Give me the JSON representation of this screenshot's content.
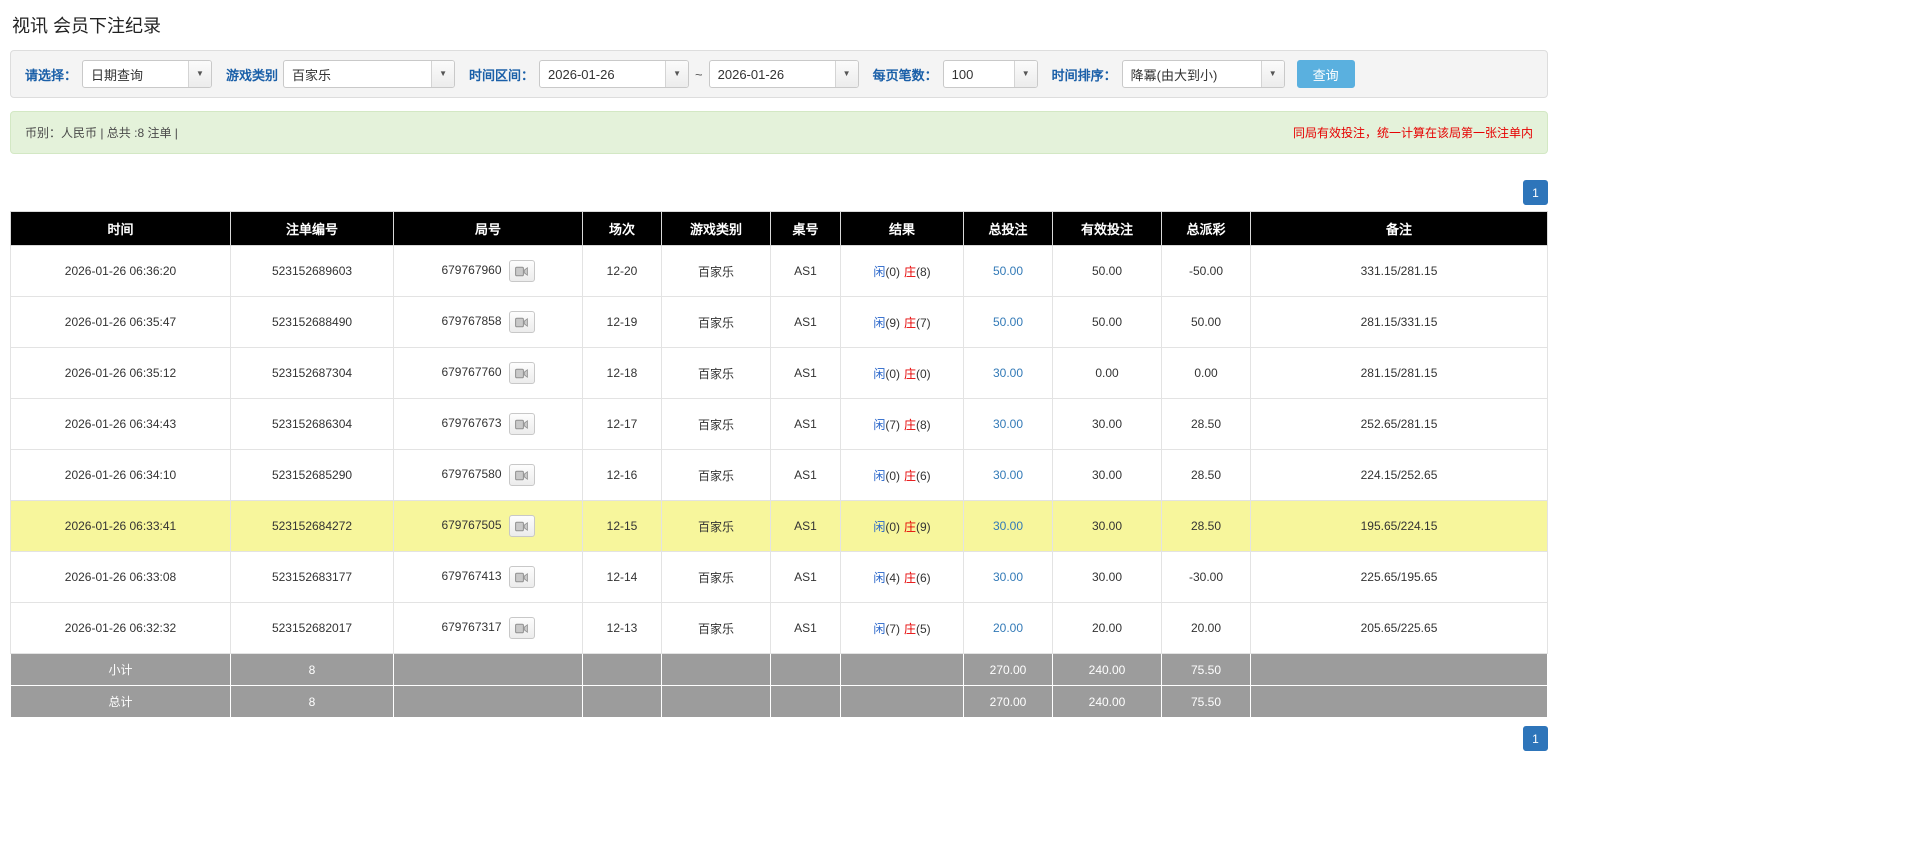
{
  "page_title": "视讯 会员下注纪录",
  "colors": {
    "label_blue": "#1a5fa8",
    "btn_blue": "#5ab0df",
    "page_blue": "#2e75ba",
    "link_blue": "#337ab7",
    "player_blue": "#2563c9",
    "banker_red": "#e60000",
    "neg_red": "#e60000",
    "highlight_yellow": "#f7f69c",
    "header_bg": "#000000",
    "summary_bg": "#9c9c9c",
    "info_bg": "#e4f2da",
    "info_border": "#d3e8c4"
  },
  "filters": {
    "select_label": "请选择：",
    "select_value": "日期查询",
    "game_type_label": "游戏类别",
    "game_type_value": "百家乐",
    "time_range_label": "时间区间：",
    "date_from": "2026-01-26",
    "range_separator": "~",
    "date_to": "2026-01-26",
    "page_size_label": "每页笔数：",
    "page_size_value": "100",
    "sort_label": "时间排序：",
    "sort_value": "降冪(由大到小)",
    "search_button": "查询",
    "dropdown_arrow": "▼"
  },
  "info_bar": {
    "left_text": "币别：人民币 | 总共 :8 注单 |",
    "right_text": "同局有效投注，统一计算在该局第一张注单内"
  },
  "pagination": {
    "current_page": "1"
  },
  "table": {
    "headers": [
      "时间",
      "注单编号",
      "局号",
      "场次",
      "游戏类别",
      "桌号",
      "结果",
      "总投注",
      "有效投注",
      "总派彩",
      "备注"
    ],
    "rows": [
      {
        "time": "2026-01-26 06:36:20",
        "bet_id": "523152689603",
        "round_no": "679767960",
        "session": "12-20",
        "game_type": "百家乐",
        "table_no": "AS1",
        "player": "闲",
        "player_score": "(0)",
        "banker": "庄",
        "banker_score": "(8)",
        "total_bet": "50.00",
        "valid_bet": "50.00",
        "payout": "-50.00",
        "note": "331.15/281.15",
        "highlight": false
      },
      {
        "time": "2026-01-26 06:35:47",
        "bet_id": "523152688490",
        "round_no": "679767858",
        "session": "12-19",
        "game_type": "百家乐",
        "table_no": "AS1",
        "player": "闲",
        "player_score": "(9)",
        "banker": "庄",
        "banker_score": "(7)",
        "total_bet": "50.00",
        "valid_bet": "50.00",
        "payout": "50.00",
        "note": "281.15/331.15",
        "highlight": false
      },
      {
        "time": "2026-01-26 06:35:12",
        "bet_id": "523152687304",
        "round_no": "679767760",
        "session": "12-18",
        "game_type": "百家乐",
        "table_no": "AS1",
        "player": "闲",
        "player_score": "(0)",
        "banker": "庄",
        "banker_score": "(0)",
        "total_bet": "30.00",
        "valid_bet": "0.00",
        "payout": "0.00",
        "note": "281.15/281.15",
        "highlight": false
      },
      {
        "time": "2026-01-26 06:34:43",
        "bet_id": "523152686304",
        "round_no": "679767673",
        "session": "12-17",
        "game_type": "百家乐",
        "table_no": "AS1",
        "player": "闲",
        "player_score": "(7)",
        "banker": "庄",
        "banker_score": "(8)",
        "total_bet": "30.00",
        "valid_bet": "30.00",
        "payout": "28.50",
        "note": "252.65/281.15",
        "highlight": false
      },
      {
        "time": "2026-01-26 06:34:10",
        "bet_id": "523152685290",
        "round_no": "679767580",
        "session": "12-16",
        "game_type": "百家乐",
        "table_no": "AS1",
        "player": "闲",
        "player_score": "(0)",
        "banker": "庄",
        "banker_score": "(6)",
        "total_bet": "30.00",
        "valid_bet": "30.00",
        "payout": "28.50",
        "note": "224.15/252.65",
        "highlight": false
      },
      {
        "time": "2026-01-26 06:33:41",
        "bet_id": "523152684272",
        "round_no": "679767505",
        "session": "12-15",
        "game_type": "百家乐",
        "table_no": "AS1",
        "player": "闲",
        "player_score": "(0)",
        "banker": "庄",
        "banker_score": "(9)",
        "total_bet": "30.00",
        "valid_bet": "30.00",
        "payout": "28.50",
        "note": "195.65/224.15",
        "highlight": true
      },
      {
        "time": "2026-01-26 06:33:08",
        "bet_id": "523152683177",
        "round_no": "679767413",
        "session": "12-14",
        "game_type": "百家乐",
        "table_no": "AS1",
        "player": "闲",
        "player_score": "(4)",
        "banker": "庄",
        "banker_score": "(6)",
        "total_bet": "30.00",
        "valid_bet": "30.00",
        "payout": "-30.00",
        "note": "225.65/195.65",
        "highlight": false
      },
      {
        "time": "2026-01-26 06:32:32",
        "bet_id": "523152682017",
        "round_no": "679767317",
        "session": "12-13",
        "game_type": "百家乐",
        "table_no": "AS1",
        "player": "闲",
        "player_score": "(7)",
        "banker": "庄",
        "banker_score": "(5)",
        "total_bet": "20.00",
        "valid_bet": "20.00",
        "payout": "20.00",
        "note": "205.65/225.65",
        "highlight": false
      }
    ],
    "subtotal": {
      "label": "小计",
      "count": "8",
      "total_bet": "270.00",
      "valid_bet": "240.00",
      "payout": "75.50"
    },
    "total": {
      "label": "总计",
      "count": "8",
      "total_bet": "270.00",
      "valid_bet": "240.00",
      "payout": "75.50"
    }
  }
}
